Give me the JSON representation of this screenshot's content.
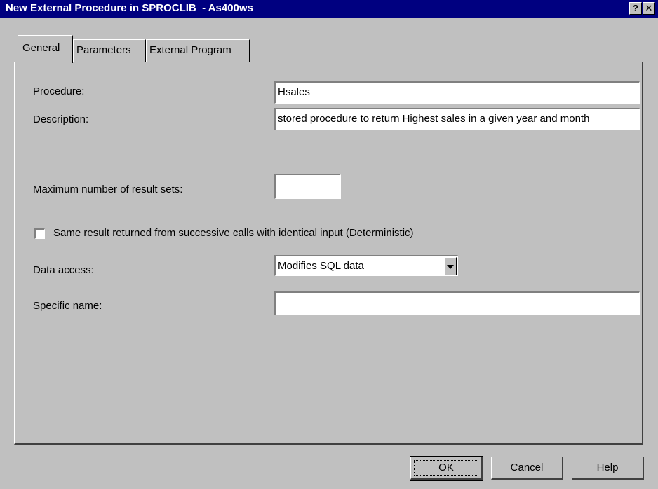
{
  "window": {
    "title": "New External Procedure in SPROCLIB  - As400ws",
    "help_glyph": "?",
    "close_glyph": "✕"
  },
  "tabs": [
    {
      "label": "General",
      "active": true
    },
    {
      "label": "Parameters",
      "active": false
    },
    {
      "label": "External Program",
      "active": false
    }
  ],
  "form": {
    "procedure_label": "Procedure:",
    "procedure_value": "Hsales",
    "description_label": "Description:",
    "description_value": "stored procedure to return Highest sales in a given year and month",
    "max_result_sets_label": "Maximum number of result sets:",
    "max_result_sets_value": "",
    "deterministic_label": "Same result returned from successive calls with identical input (Deterministic)",
    "deterministic_checked": false,
    "data_access_label": "Data access:",
    "data_access_value": "Modifies SQL data",
    "specific_name_label": "Specific name:",
    "specific_name_value": ""
  },
  "buttons": {
    "ok": "OK",
    "cancel": "Cancel",
    "help": "Help"
  }
}
